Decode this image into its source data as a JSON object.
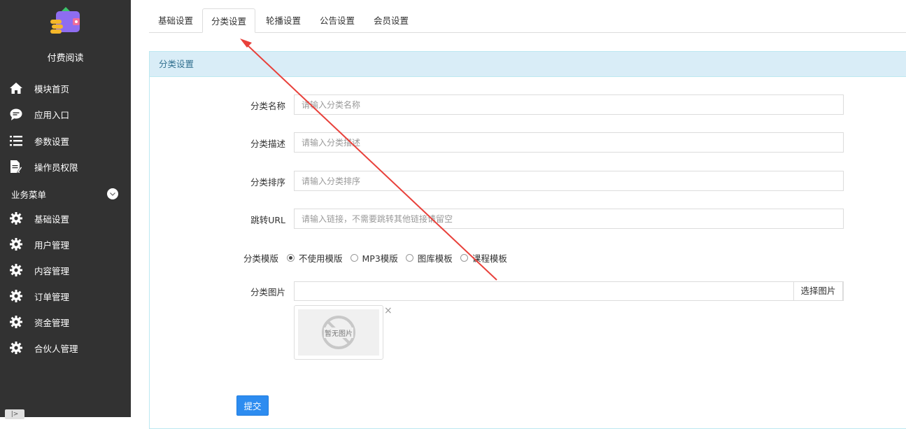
{
  "sidebar": {
    "app_title": "付费阅读",
    "items": [
      {
        "label": "模块首页",
        "icon": "home-icon"
      },
      {
        "label": "应用入口",
        "icon": "chat-bubble-icon"
      },
      {
        "label": "参数设置",
        "icon": "list-icon"
      },
      {
        "label": "操作员权限",
        "icon": "document-edit-icon"
      }
    ],
    "section_label": "业务菜单",
    "business_items": [
      {
        "label": "基础设置",
        "icon": "gear-icon"
      },
      {
        "label": "用户管理",
        "icon": "gear-icon"
      },
      {
        "label": "内容管理",
        "icon": "gear-icon"
      },
      {
        "label": "订单管理",
        "icon": "gear-icon"
      },
      {
        "label": "资金管理",
        "icon": "gear-icon"
      },
      {
        "label": "合伙人管理",
        "icon": "gear-icon"
      }
    ],
    "collapse_label": "|>"
  },
  "tabs": [
    {
      "label": "基础设置",
      "active": false
    },
    {
      "label": "分类设置",
      "active": true
    },
    {
      "label": "轮播设置",
      "active": false
    },
    {
      "label": "公告设置",
      "active": false
    },
    {
      "label": "会员设置",
      "active": false
    }
  ],
  "panel": {
    "title": "分类设置"
  },
  "form": {
    "name": {
      "label": "分类名称",
      "placeholder": "请输入分类名称",
      "value": ""
    },
    "desc": {
      "label": "分类描述",
      "placeholder": "请输入分类描述",
      "value": ""
    },
    "sort": {
      "label": "分类排序",
      "placeholder": "请输入分类排序",
      "value": ""
    },
    "url": {
      "label": "跳转URL",
      "placeholder": "请输入链接，不需要跳转其他链接请留空",
      "value": ""
    },
    "template": {
      "label": "分类模版",
      "options": [
        "不使用模版",
        "MP3模版",
        "图库模板",
        "课程模板"
      ],
      "selected": "不使用模版"
    },
    "image": {
      "label": "分类图片",
      "button_label": "选择图片",
      "placeholder_text": "暂无图片",
      "remove_label": "×"
    },
    "submit_label": "提交"
  },
  "colors": {
    "sidebar_bg": "#323232",
    "panel_head_bg": "#d9edf7",
    "primary": "#2d8cf0",
    "annotation_arrow": "#e8403a"
  }
}
